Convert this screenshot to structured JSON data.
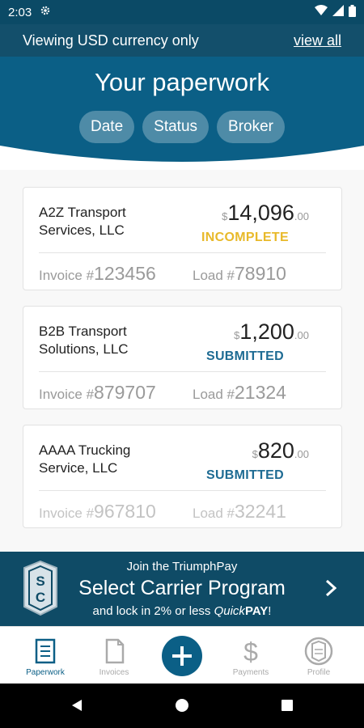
{
  "status_bar": {
    "time": "2:03"
  },
  "currency_bar": {
    "message": "Viewing USD currency only",
    "view_all": "view all"
  },
  "header": {
    "title": "Your paperwork",
    "filters": [
      "Date",
      "Status",
      "Broker"
    ]
  },
  "cards": [
    {
      "company_line1": "A2Z Transport",
      "company_line2": "Services, LLC",
      "currency_symbol": "$",
      "amount_whole": "14,096",
      "amount_cents": ".00",
      "status": "INCOMPLETE",
      "status_color": "#e8b92a",
      "invoice_label": "Invoice #",
      "invoice_number": "123456",
      "load_label": "Load #",
      "load_number": "78910"
    },
    {
      "company_line1": "B2B Transport",
      "company_line2": "Solutions, LLC",
      "currency_symbol": "$",
      "amount_whole": "1,200",
      "amount_cents": ".00",
      "status": "SUBMITTED",
      "status_color": "#1e6b93",
      "invoice_label": "Invoice #",
      "invoice_number": "879707",
      "load_label": "Load #",
      "load_number": "21324"
    },
    {
      "company_line1": "AAAA Trucking",
      "company_line2": "Service, LLC",
      "currency_symbol": "$",
      "amount_whole": "820",
      "amount_cents": ".00",
      "status": "SUBMITTED",
      "status_color": "#1e6b93",
      "invoice_label": "Invoice #",
      "invoice_number": "967810",
      "load_label": "Load #",
      "load_number": "32241"
    }
  ],
  "promo": {
    "line1": "Join the TriumphPay",
    "line2": "Select Carrier Program",
    "line3_prefix": "and lock in 2% or less ",
    "line3_quick": "Quick",
    "line3_pay": "PAY",
    "line3_suffix": "!",
    "badge_letters": "SC"
  },
  "bottom_nav": {
    "items": [
      {
        "label": "Paperwork",
        "icon": "paperwork-icon"
      },
      {
        "label": "Invoices",
        "icon": "invoice-icon"
      },
      {
        "label": "",
        "icon": "plus-icon"
      },
      {
        "label": "Payments",
        "icon": "dollar-icon"
      },
      {
        "label": "Profile",
        "icon": "profile-badge-icon"
      }
    ]
  },
  "colors": {
    "primary": "#0b5f86",
    "dark_bar": "#134f6b",
    "incomplete": "#e8b92a",
    "submitted": "#1e6b93"
  }
}
